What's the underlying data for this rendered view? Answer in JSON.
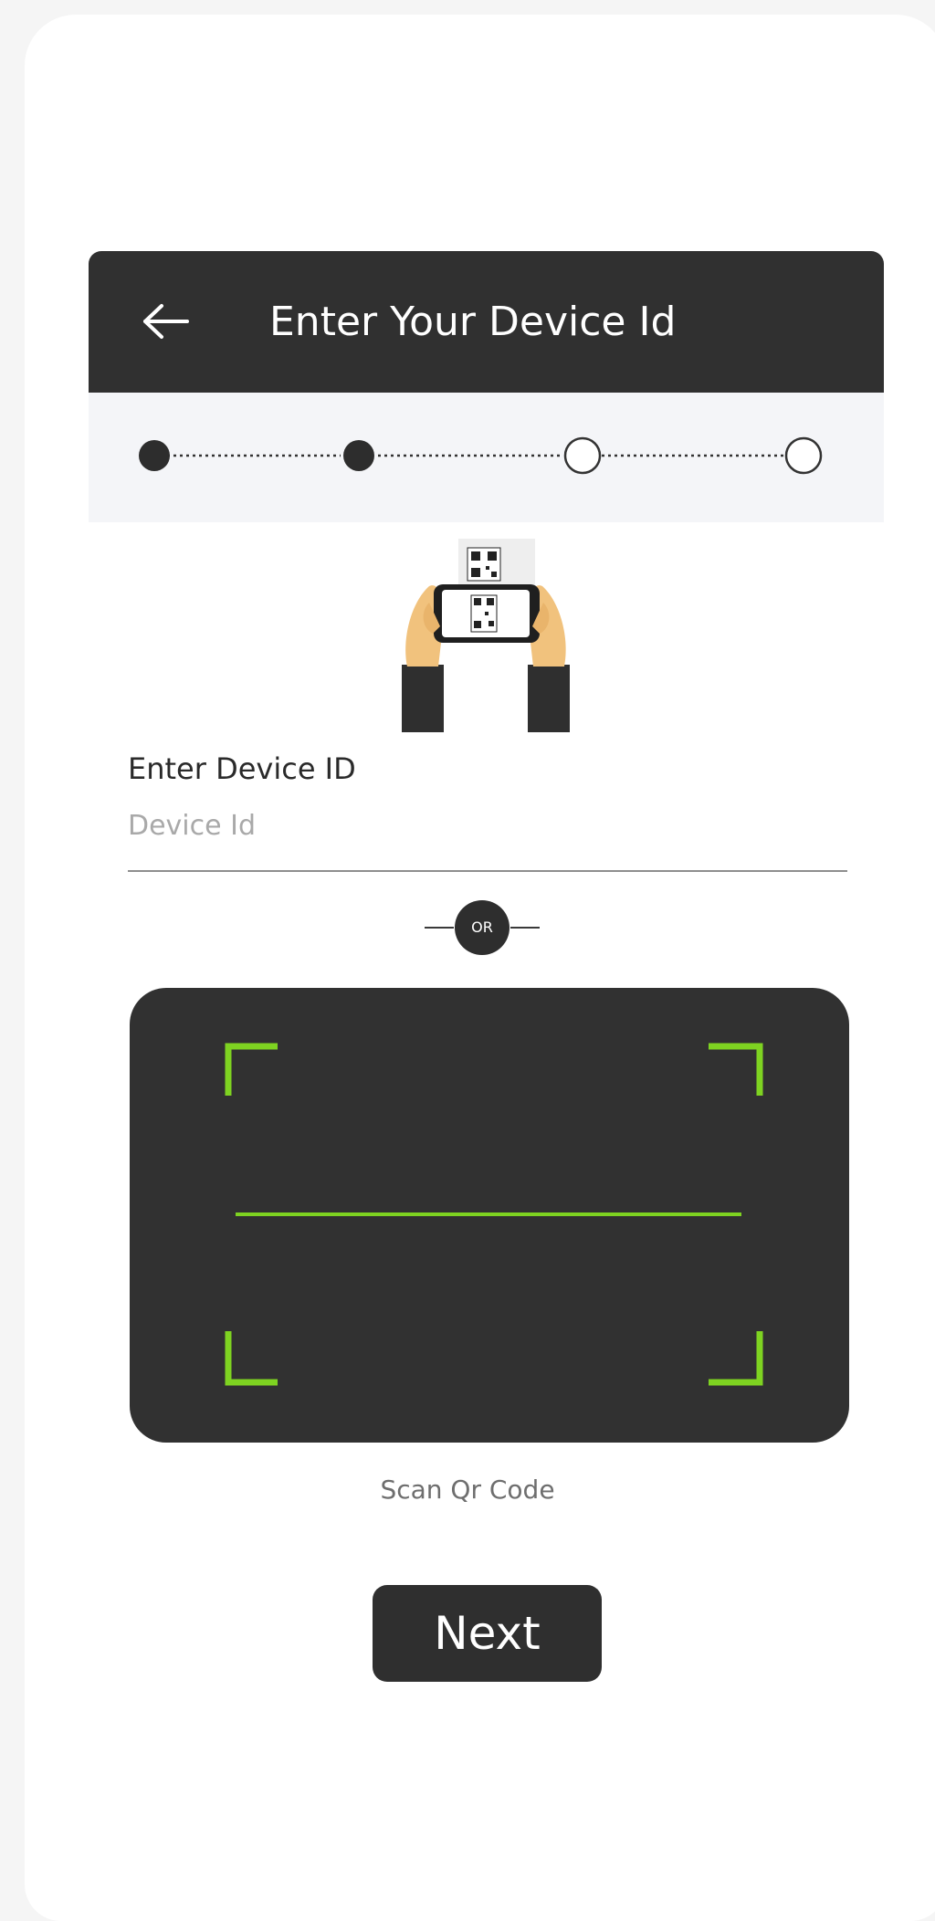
{
  "header": {
    "back_icon": "arrow-left-icon",
    "title": "Enter Your Device Id"
  },
  "stepper": {
    "total_steps": 4,
    "completed_steps": 2
  },
  "illustration": {
    "icon": "hands-scanning-qr-icon"
  },
  "form": {
    "label": "Enter Device ID",
    "value": "",
    "placeholder": "Device Id"
  },
  "divider": {
    "label": "OR"
  },
  "scanner": {
    "icon": "qr-scanner-frame-icon",
    "caption": "Scan Qr Code"
  },
  "actions": {
    "next_label": "Next"
  },
  "colors": {
    "header_bg": "#303030",
    "stepper_bg": "#f4f5f8",
    "scanner_bg": "#313131",
    "scanner_accent": "#7ed321",
    "button_bg": "#2f2f2f"
  }
}
